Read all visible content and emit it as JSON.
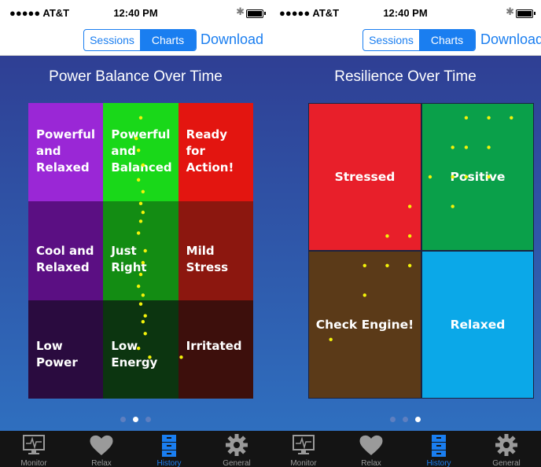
{
  "status_bar": {
    "carrier": "●●●●● AT&T",
    "wifi": "wifi-icon",
    "time": "12:40 PM",
    "bluetooth": "bluetooth-icon",
    "battery": "battery-icon"
  },
  "nav": {
    "segments": [
      "Sessions",
      "Charts"
    ],
    "active_segment": "Charts",
    "download_label": "Download"
  },
  "left_screen": {
    "title": "Power Balance Over Time",
    "cells": [
      {
        "label": "Powerful and Relaxed",
        "color": "#9a27d6"
      },
      {
        "label": "Powerful and Balanced",
        "color": "#19d819"
      },
      {
        "label": "Ready for Action!",
        "color": "#e31510"
      },
      {
        "label": "Cool and Relaxed",
        "color": "#5b0f83"
      },
      {
        "label": "Just Right",
        "color": "#138c13"
      },
      {
        "label": "Mild Stress",
        "color": "#8c170f"
      },
      {
        "label": "Low Power",
        "color": "#2a0b3f"
      },
      {
        "label": "Low Energy",
        "color": "#0c3510"
      },
      {
        "label": "Irritated",
        "color": "#3d0f0c"
      }
    ],
    "dot_color": "#f3f30a",
    "dots": [
      [
        0.5,
        0.05
      ],
      [
        0.48,
        0.12
      ],
      [
        0.49,
        0.16
      ],
      [
        0.51,
        0.21
      ],
      [
        0.49,
        0.26
      ],
      [
        0.51,
        0.3
      ],
      [
        0.5,
        0.34
      ],
      [
        0.51,
        0.37
      ],
      [
        0.5,
        0.4
      ],
      [
        0.49,
        0.44
      ],
      [
        0.52,
        0.5
      ],
      [
        0.51,
        0.54
      ],
      [
        0.5,
        0.58
      ],
      [
        0.49,
        0.62
      ],
      [
        0.51,
        0.65
      ],
      [
        0.5,
        0.68
      ],
      [
        0.52,
        0.72
      ],
      [
        0.51,
        0.74
      ],
      [
        0.52,
        0.78
      ],
      [
        0.49,
        0.83
      ],
      [
        0.54,
        0.86
      ],
      [
        0.68,
        0.86
      ]
    ],
    "pager": {
      "count": 3,
      "active": 1
    }
  },
  "right_screen": {
    "title": "Resilience Over Time",
    "cells": [
      {
        "label": "Stressed",
        "color": "#e81f2a"
      },
      {
        "label": "Positive",
        "color": "#0aa04a"
      },
      {
        "label": "Check Engine!",
        "color": "#5b3a18"
      },
      {
        "label": "Relaxed",
        "color": "#0ba8e8"
      }
    ],
    "dot_color": "#f3f30a",
    "dots": [
      [
        0.7,
        0.05
      ],
      [
        0.8,
        0.05
      ],
      [
        0.9,
        0.05
      ],
      [
        0.64,
        0.15
      ],
      [
        0.7,
        0.15
      ],
      [
        0.8,
        0.15
      ],
      [
        0.54,
        0.25
      ],
      [
        0.64,
        0.25
      ],
      [
        0.7,
        0.25
      ],
      [
        0.8,
        0.25
      ],
      [
        0.64,
        0.35
      ],
      [
        0.45,
        0.35
      ],
      [
        0.35,
        0.45
      ],
      [
        0.45,
        0.45
      ],
      [
        0.25,
        0.55
      ],
      [
        0.35,
        0.55
      ],
      [
        0.45,
        0.55
      ],
      [
        0.25,
        0.65
      ],
      [
        0.1,
        0.8
      ]
    ],
    "pager": {
      "count": 3,
      "active": 2
    }
  },
  "tabs": [
    {
      "label": "Monitor",
      "icon": "monitor-icon"
    },
    {
      "label": "Relax",
      "icon": "heart-icon"
    },
    {
      "label": "History",
      "icon": "history-icon"
    },
    {
      "label": "General",
      "icon": "gear-icon"
    }
  ],
  "active_tab": "History"
}
